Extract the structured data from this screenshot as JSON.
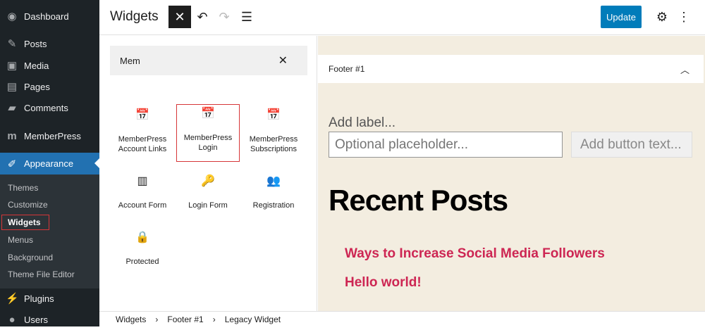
{
  "sidebar": {
    "items": [
      {
        "label": "Dashboard",
        "icon": "dashboard-icon"
      },
      {
        "label": "Posts",
        "icon": "pin-icon"
      },
      {
        "label": "Media",
        "icon": "media-icon"
      },
      {
        "label": "Pages",
        "icon": "pages-icon"
      },
      {
        "label": "Comments",
        "icon": "comment-icon"
      },
      {
        "label": "MemberPress",
        "icon": "memberpress-icon"
      },
      {
        "label": "Appearance",
        "icon": "brush-icon"
      },
      {
        "label": "Plugins",
        "icon": "plugin-icon"
      },
      {
        "label": "Users",
        "icon": "users-icon"
      }
    ],
    "submenu": [
      "Themes",
      "Customize",
      "Widgets",
      "Menus",
      "Background",
      "Theme File Editor"
    ]
  },
  "header": {
    "title": "Widgets",
    "update": "Update"
  },
  "inserter": {
    "search_value": "Mem",
    "blocks": [
      {
        "label": "MemberPress Account Links",
        "icon": "calendar-icon"
      },
      {
        "label": "MemberPress Login",
        "icon": "calendar-icon"
      },
      {
        "label": "MemberPress Subscriptions",
        "icon": "calendar-icon"
      },
      {
        "label": "Account Form",
        "icon": "form-icon"
      },
      {
        "label": "Login Form",
        "icon": "key-icon"
      },
      {
        "label": "Registration",
        "icon": "group-icon"
      },
      {
        "label": "Protected",
        "icon": "lock-icon"
      }
    ]
  },
  "canvas": {
    "area": "Footer #1",
    "label_placeholder": "Add label...",
    "input_placeholder": "Optional placeholder...",
    "button_placeholder": "Add button text...",
    "heading": "Recent Posts",
    "posts": [
      "Ways to Increase Social Media Followers",
      "Hello world!"
    ]
  },
  "breadcrumb": [
    "Widgets",
    "Footer #1",
    "Legacy Widget"
  ],
  "colors": {
    "sidebar": "#1d2327",
    "active": "#2271b1",
    "accent": "#007cba",
    "link": "#cd2653",
    "highlight": "#d63638"
  }
}
